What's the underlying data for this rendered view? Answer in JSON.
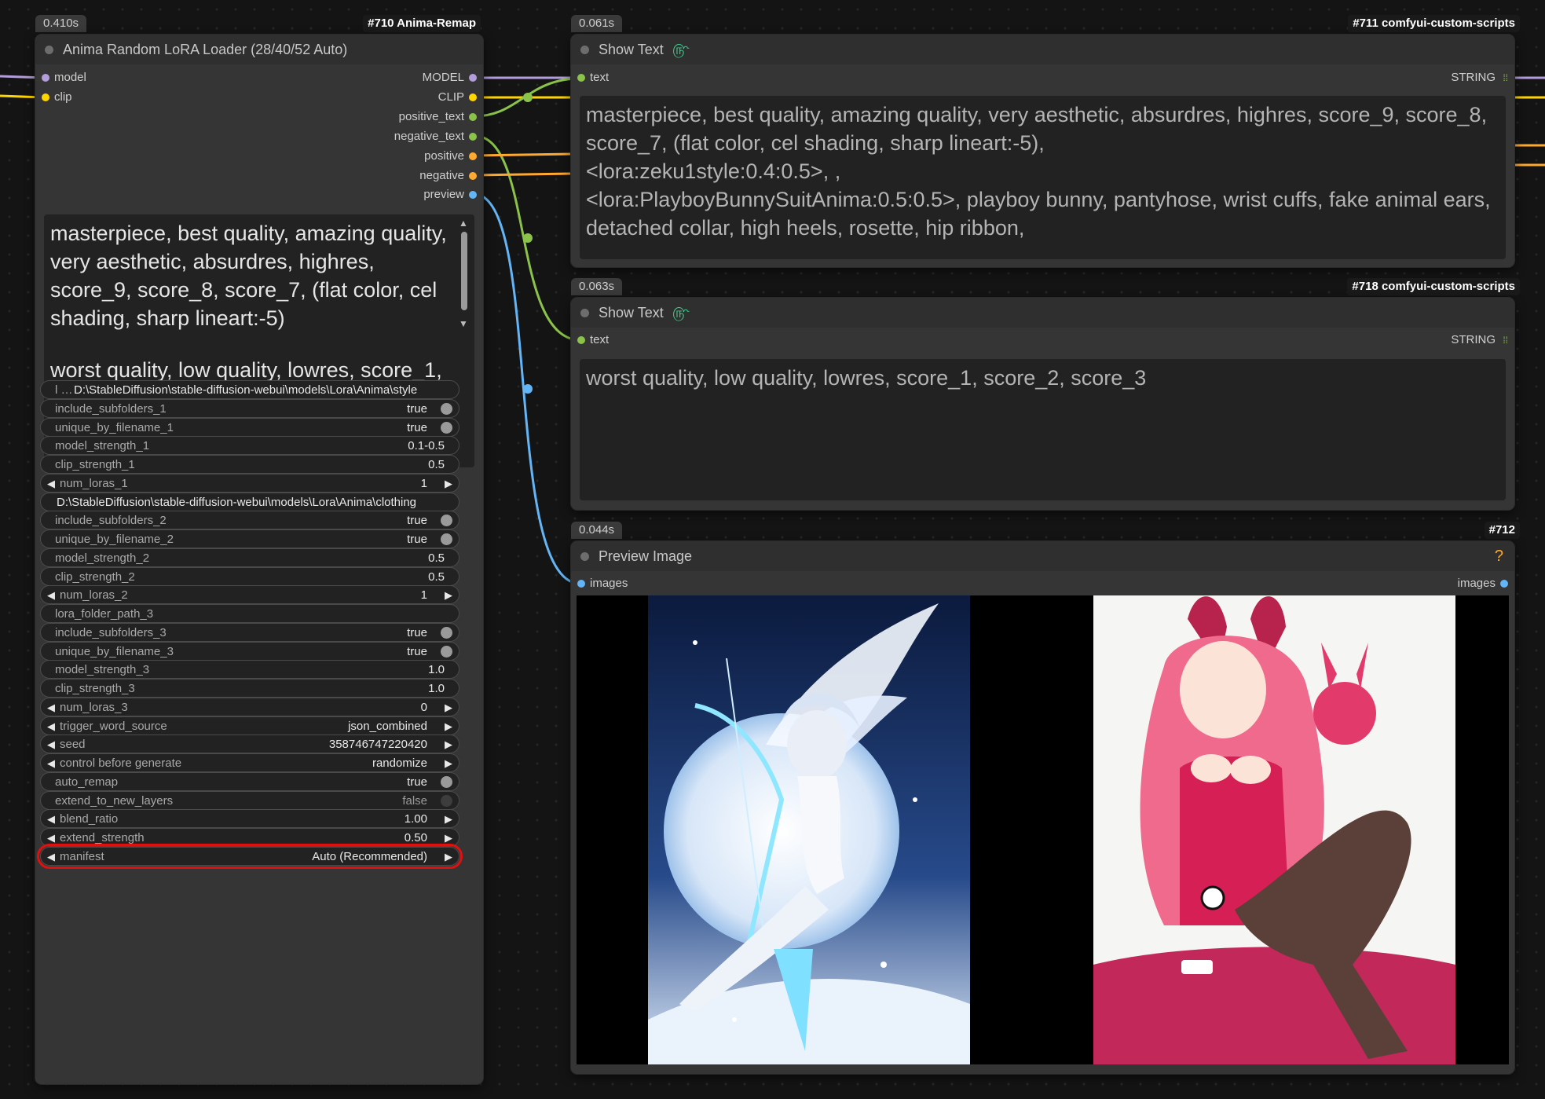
{
  "node710": {
    "time": "0.410s",
    "id_label": "#710 Anima-Remap",
    "title": "Anima Random LoRA Loader (28/40/52 Auto)",
    "inputs": [
      "model",
      "clip"
    ],
    "outputs": [
      "MODEL",
      "CLIP",
      "positive_text",
      "negative_text",
      "positive",
      "negative",
      "preview"
    ],
    "positive_prompt": "masterpiece, best quality, amazing quality, very aesthetic, absurdres, highres, score_9, score_8, score_7, (flat color, cel shading, sharp lineart:-5)",
    "negative_prompt": "worst quality, low quality, lowres, score_1, score_2, score_3",
    "widgets": [
      {
        "kind": "full",
        "label": "l …",
        "value": "D:\\StableDiffusion\\stable-diffusion-webui\\models\\Lora\\Anima\\style"
      },
      {
        "kind": "toggle",
        "label": "include_subfolders_1",
        "value": "true"
      },
      {
        "kind": "toggle",
        "label": "unique_by_filename_1",
        "value": "true"
      },
      {
        "kind": "number",
        "label": "model_strength_1",
        "value": "0.1-0.5"
      },
      {
        "kind": "number",
        "label": "clip_strength_1",
        "value": "0.5"
      },
      {
        "kind": "arrow",
        "label": "num_loras_1",
        "value": "1"
      },
      {
        "kind": "full",
        "label": "",
        "value": "D:\\StableDiffusion\\stable-diffusion-webui\\models\\Lora\\Anima\\clothing"
      },
      {
        "kind": "toggle",
        "label": "include_subfolders_2",
        "value": "true"
      },
      {
        "kind": "toggle",
        "label": "unique_by_filename_2",
        "value": "true"
      },
      {
        "kind": "number",
        "label": "model_strength_2",
        "value": "0.5"
      },
      {
        "kind": "number",
        "label": "clip_strength_2",
        "value": "0.5"
      },
      {
        "kind": "arrow",
        "label": "num_loras_2",
        "value": "1"
      },
      {
        "kind": "number",
        "label": "lora_folder_path_3",
        "value": ""
      },
      {
        "kind": "toggle",
        "label": "include_subfolders_3",
        "value": "true"
      },
      {
        "kind": "toggle",
        "label": "unique_by_filename_3",
        "value": "true"
      },
      {
        "kind": "number",
        "label": "model_strength_3",
        "value": "1.0"
      },
      {
        "kind": "number",
        "label": "clip_strength_3",
        "value": "1.0"
      },
      {
        "kind": "arrow",
        "label": "num_loras_3",
        "value": "0"
      },
      {
        "kind": "arrow",
        "label": "trigger_word_source",
        "value": "json_combined"
      },
      {
        "kind": "arrow",
        "label": "seed",
        "value": "358746747220420"
      },
      {
        "kind": "arrow",
        "label": "control before generate",
        "value": "randomize"
      },
      {
        "kind": "toggle",
        "label": "auto_remap",
        "value": "true"
      },
      {
        "kind": "toggle-off",
        "label": "extend_to_new_layers",
        "value": "false"
      },
      {
        "kind": "arrow",
        "label": "blend_ratio",
        "value": "1.00"
      },
      {
        "kind": "arrow",
        "label": "extend_strength",
        "value": "0.50"
      },
      {
        "kind": "arrow",
        "label": "manifest",
        "value": "Auto (Recommended)"
      }
    ]
  },
  "node711": {
    "time": "0.061s",
    "id_label": "#711 comfyui-custom-scripts",
    "title": "Show Text",
    "input": "text",
    "output": "STRING",
    "text": "masterpiece, best quality, amazing quality, very aesthetic, absurdres, highres, score_9, score_8,\nscore_7, (flat color, cel shading, sharp lineart:-5),\n<lora:zeku1style:0.4:0.5>, ,\n<lora:PlayboyBunnySuitAnima:0.5:0.5>, playboy bunny, pantyhose, wrist cuffs, fake animal ears,\ndetached collar, high heels, rosette, hip ribbon,"
  },
  "node718": {
    "time": "0.063s",
    "id_label": "#718 comfyui-custom-scripts",
    "title": "Show Text",
    "input": "text",
    "output": "STRING",
    "text": "worst quality, low quality, lowres, score_1, score_2, score_3"
  },
  "node712": {
    "time": "0.044s",
    "id_label": "#712",
    "title": "Preview Image",
    "input": "images",
    "output": "images",
    "help": "?"
  },
  "colors": {
    "model": "#b39ddb",
    "clip": "#ffd500",
    "string": "#8bc34a",
    "conditioning": "#ffa931",
    "image": "#64b5f6"
  }
}
